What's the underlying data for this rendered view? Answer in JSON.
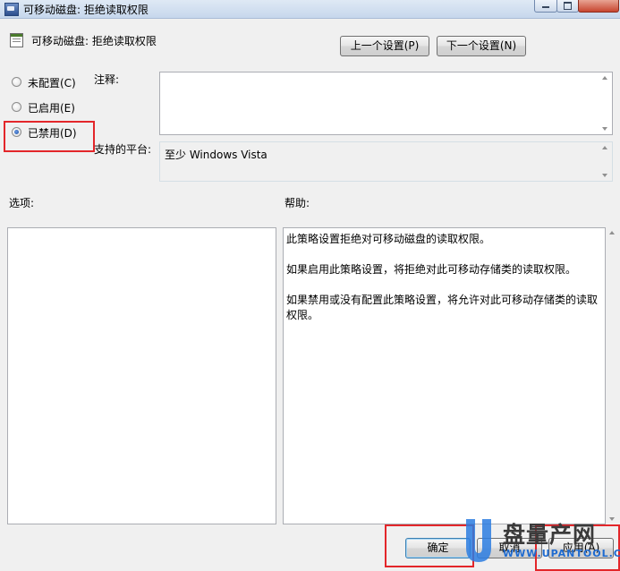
{
  "window": {
    "title": "可移动磁盘: 拒绝读取权限"
  },
  "header": {
    "policy_title": "可移动磁盘: 拒绝读取权限",
    "prev_button": "上一个设置(P)",
    "next_button": "下一个设置(N)"
  },
  "state": {
    "options": [
      {
        "label": "未配置(C)",
        "checked": false
      },
      {
        "label": "已启用(E)",
        "checked": false
      },
      {
        "label": "已禁用(D)",
        "checked": true
      }
    ]
  },
  "comment": {
    "label": "注释:",
    "value": ""
  },
  "platform": {
    "label": "支持的平台:",
    "value": "至少 Windows Vista"
  },
  "options_section": {
    "label": "选项:"
  },
  "help_section": {
    "label": "帮助:",
    "paragraphs": [
      "此策略设置拒绝对可移动磁盘的读取权限。",
      "如果启用此策略设置，将拒绝对此可移动存储类的读取权限。",
      "如果禁用或没有配置此策略设置，将允许对此可移动存储类的读取权限。"
    ]
  },
  "footer": {
    "ok_button": "确定",
    "cancel_button": "取消",
    "apply_button": "应用(A)"
  },
  "watermark": {
    "big_text": "盘量产网",
    "small_text": "WWW.UPANTOOL.COM"
  },
  "colors": {
    "highlight": "#e3262a",
    "title_bar": "#c6d7ec",
    "watermark_accent": "#1f6bd0"
  },
  "icons": {
    "app": "policy-app-icon",
    "policy": "policy-setting-icon",
    "window_controls": [
      "minimize-icon",
      "maximize-icon",
      "close-icon"
    ]
  }
}
